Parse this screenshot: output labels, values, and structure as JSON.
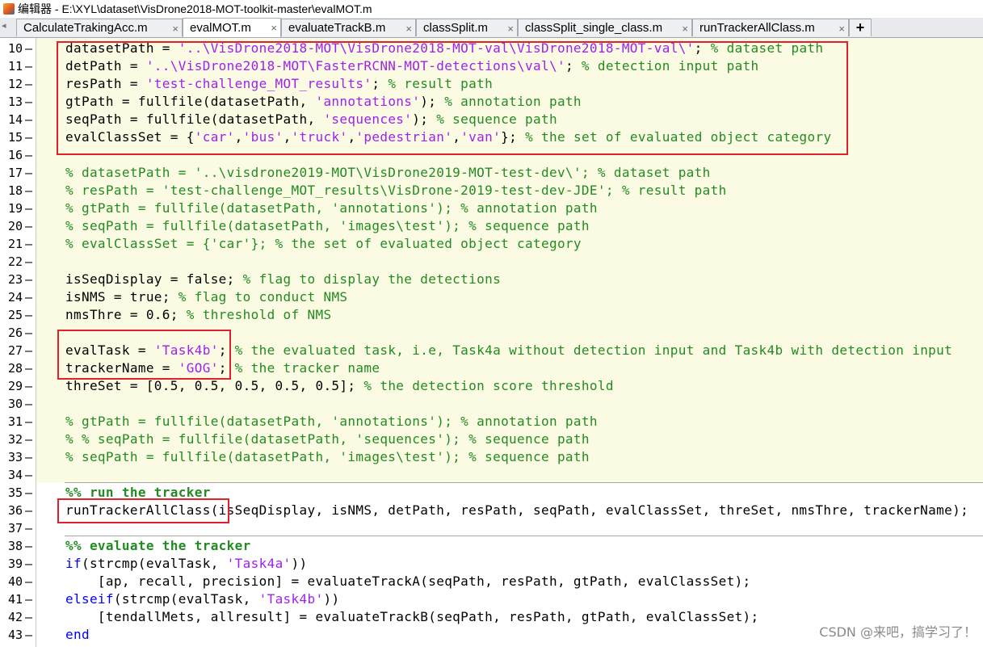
{
  "window": {
    "title": "编辑器 - E:\\XYL\\dataset\\VisDrone2018-MOT-toolkit-master\\evalMOT.m"
  },
  "tabs": [
    {
      "label": "CalculateTrakingAcc.m",
      "active": false
    },
    {
      "label": "evalMOT.m",
      "active": true
    },
    {
      "label": "evaluateTrackB.m",
      "active": false
    },
    {
      "label": "classSplit.m",
      "active": false
    },
    {
      "label": "classSplit_single_class.m",
      "active": false
    },
    {
      "label": "runTrackerAllClass.m",
      "active": false
    }
  ],
  "tab_close_glyph": "×",
  "tab_add_glyph": "+",
  "line_marker": "–",
  "colors": {
    "keyword": "#0000ff",
    "string": "#a020f0",
    "comment": "#228b22",
    "cell_background": "#fbfbe3",
    "highlight_box": "#e0202a"
  },
  "lines": [
    {
      "num": "10",
      "code": "datasetPath = '..\\VisDrone2018-MOT\\VisDrone2018-MOT-val\\VisDrone2018-MOT-val\\'; % dataset path"
    },
    {
      "num": "11",
      "code": "detPath = '..\\VisDrone2018-MOT\\FasterRCNN-MOT-detections\\val\\'; % detection input path"
    },
    {
      "num": "12",
      "code": "resPath = 'test-challenge_MOT_results'; % result path"
    },
    {
      "num": "13",
      "code": "gtPath = fullfile(datasetPath, 'annotations'); % annotation path"
    },
    {
      "num": "14",
      "code": "seqPath = fullfile(datasetPath, 'sequences'); % sequence path"
    },
    {
      "num": "15",
      "code": "evalClassSet = {'car','bus','truck','pedestrian','van'}; % the set of evaluated object category"
    },
    {
      "num": "16",
      "code": ""
    },
    {
      "num": "17",
      "code": "% datasetPath = '..\\visdrone2019-MOT\\VisDrone2019-MOT-test-dev\\'; % dataset path"
    },
    {
      "num": "18",
      "code": "% resPath = 'test-challenge_MOT_results\\VisDrone-2019-test-dev-JDE'; % result path"
    },
    {
      "num": "19",
      "code": "% gtPath = fullfile(datasetPath, 'annotations'); % annotation path"
    },
    {
      "num": "20",
      "code": "% seqPath = fullfile(datasetPath, 'images\\test'); % sequence path"
    },
    {
      "num": "21",
      "code": "% evalClassSet = {'car'}; % the set of evaluated object category"
    },
    {
      "num": "22",
      "code": ""
    },
    {
      "num": "23",
      "code": "isSeqDisplay = false; % flag to display the detections"
    },
    {
      "num": "24",
      "code": "isNMS = true; % flag to conduct NMS"
    },
    {
      "num": "25",
      "code": "nmsThre = 0.6; % threshold of NMS"
    },
    {
      "num": "26",
      "code": ""
    },
    {
      "num": "27",
      "code": "evalTask = 'Task4b'; % the evaluated task, i.e, Task4a without detection input and Task4b with detection input"
    },
    {
      "num": "28",
      "code": "trackerName = 'GOG'; % the tracker name"
    },
    {
      "num": "29",
      "code": "threSet = [0.5, 0.5, 0.5, 0.5, 0.5]; % the detection score threshold"
    },
    {
      "num": "30",
      "code": ""
    },
    {
      "num": "31",
      "code": "% gtPath = fullfile(datasetPath, 'annotations'); % annotation path"
    },
    {
      "num": "32",
      "code": "% % seqPath = fullfile(datasetPath, 'sequences'); % sequence path"
    },
    {
      "num": "33",
      "code": "% seqPath = fullfile(datasetPath, 'images\\test'); % sequence path"
    },
    {
      "num": "34",
      "code": ""
    },
    {
      "num": "35",
      "code": "%% run the tracker"
    },
    {
      "num": "36",
      "code": "runTrackerAllClass(isSeqDisplay, isNMS, detPath, resPath, seqPath, evalClassSet, threSet, nmsThre, trackerName);"
    },
    {
      "num": "37",
      "code": ""
    },
    {
      "num": "38",
      "code": "%% evaluate the tracker"
    },
    {
      "num": "39",
      "code": "if(strcmp(evalTask, 'Task4a'))"
    },
    {
      "num": "40",
      "code": "    [ap, recall, precision] = evaluateTrackA(seqPath, resPath, gtPath, evalClassSet);"
    },
    {
      "num": "41",
      "code": "elseif(strcmp(evalTask, 'Task4b'))"
    },
    {
      "num": "42",
      "code": "    [tendallMets, allresult] = evaluateTrackB(seqPath, resPath, gtPath, evalClassSet);"
    },
    {
      "num": "43",
      "code": "end"
    }
  ],
  "watermark": "CSDN @来吧，搞学习了！"
}
